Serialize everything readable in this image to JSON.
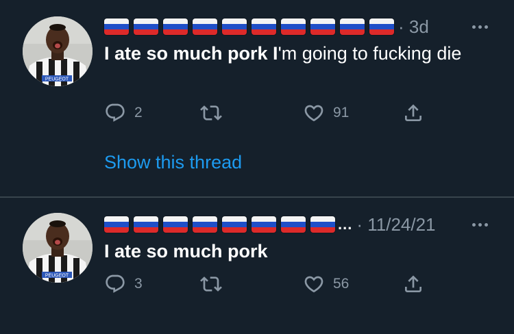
{
  "tweets": [
    {
      "flags_count": 10,
      "truncated": "",
      "time": "· 3d",
      "text_bold_1": "I ate so much pork I",
      "text_rest": "'m going to fucking die",
      "replies": "2",
      "retweets": "",
      "likes": "91",
      "show_thread": "Show this thread",
      "avatar_jersey_text": "PEUGEOT"
    },
    {
      "flags_count": 8,
      "truncated": "...",
      "time": "· 11/24/21",
      "text_bold_1": "I ate so much pork",
      "replies": "3",
      "retweets": "",
      "likes": "56",
      "avatar_jersey_text": "PEUGEOT"
    }
  ],
  "colors": {
    "background": "#15202b",
    "divider": "#38444d",
    "secondary_text": "#8b98a5",
    "link": "#1d9bf0"
  },
  "icons": [
    "reply-icon",
    "retweet-icon",
    "like-icon",
    "share-icon",
    "more-icon"
  ]
}
